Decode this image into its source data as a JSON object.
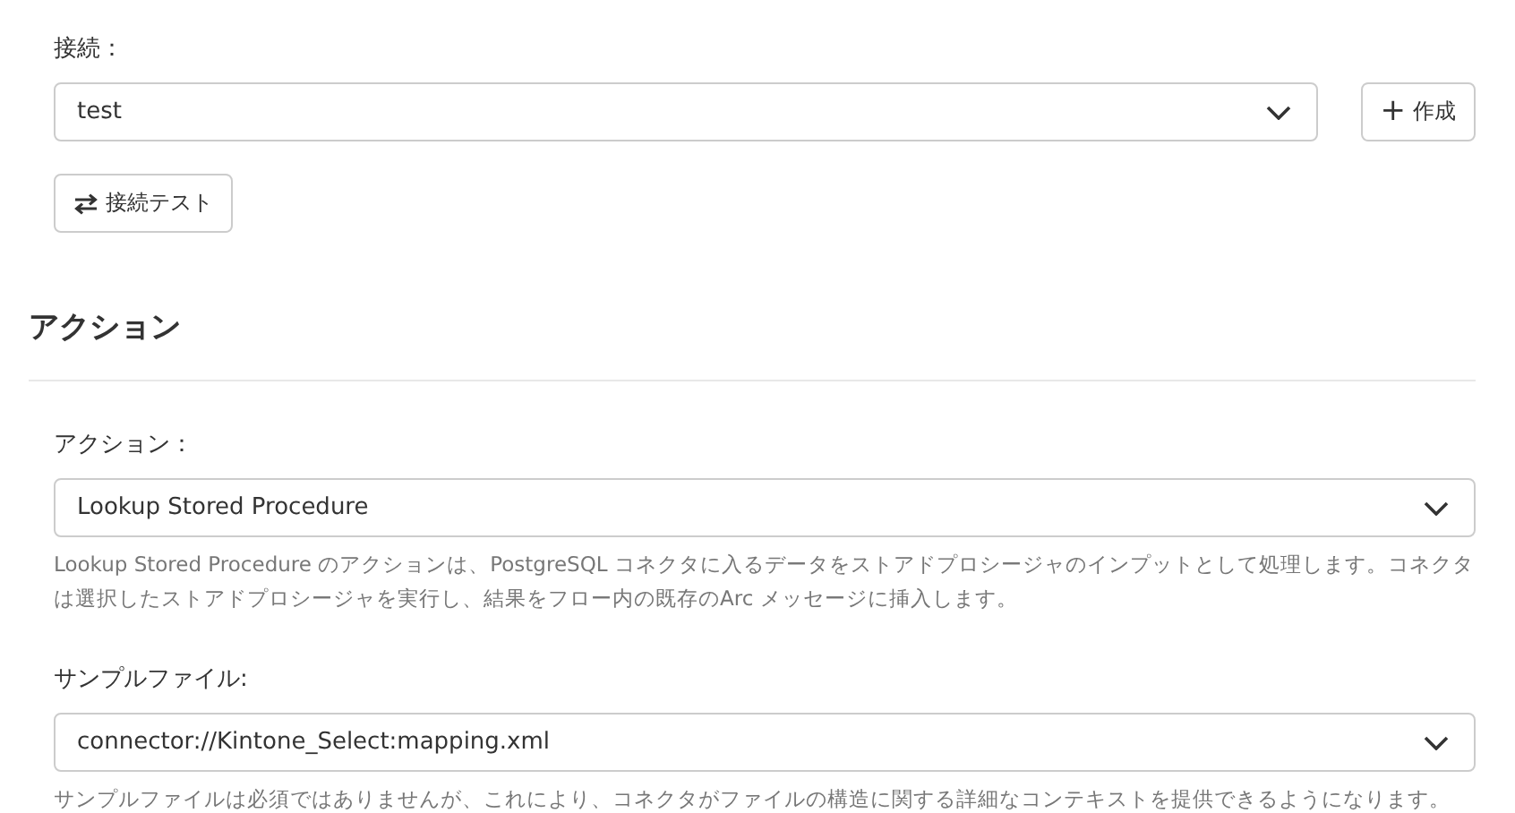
{
  "connection": {
    "label": "接続：",
    "value": "test",
    "create_button": {
      "icon": "+",
      "label": "作成"
    },
    "test_button": {
      "label": "接続テスト"
    }
  },
  "section": {
    "title": "アクション"
  },
  "fields": [
    {
      "label": "アクション：",
      "value": "Lookup Stored Procedure",
      "description": "Lookup Stored Procedure のアクションは、PostgreSQL コネクタに入るデータをストアドプロシージャのインプットとして処理します。コネクタは選択したストアドプロシージャを実行し、結果をフロー内の既存のArc メッセージに挿入します。"
    },
    {
      "label": "サンプルファイル:",
      "value": "connector://Kintone_Select:mapping.xml",
      "description": "サンプルファイルは必須ではありませんが、これにより、コネクタがファイルの構造に関する詳細なコンテキストを提供できるようになります。"
    }
  ]
}
